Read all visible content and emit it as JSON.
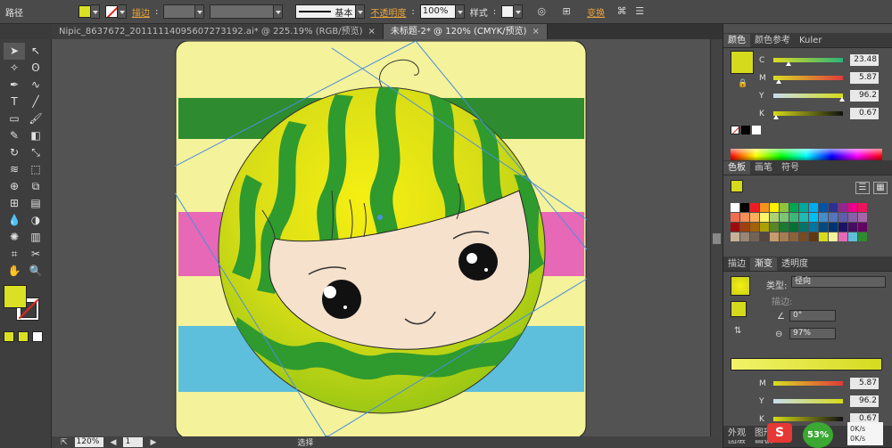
{
  "control_bar": {
    "object_type": "路径",
    "fill_color": "#dbe024",
    "stroke_label": "描边",
    "stroke_style": "基本",
    "opacity_label": "不透明度",
    "opacity_value": "100%",
    "style_label": "样式",
    "transform_label": "变换"
  },
  "tabs": [
    {
      "title": "Nipic_8637672_20111114095607273192.ai* @ 225.19% (RGB/预览)",
      "close": "×"
    },
    {
      "title": "未标题-2* @ 120% (CMYK/预览)",
      "close": "×"
    }
  ],
  "status": {
    "zoom": "120%",
    "artboard": "1",
    "mode": "选择"
  },
  "color_panel": {
    "tabs": [
      "颜色",
      "颜色参考",
      "Kuler"
    ],
    "current_color": "#d6da1c",
    "channels": [
      {
        "name": "C",
        "value": "23.48"
      },
      {
        "name": "M",
        "value": "5.87"
      },
      {
        "name": "Y",
        "value": "96.2"
      },
      {
        "name": "K",
        "value": "0.67"
      }
    ]
  },
  "swatches_panel": {
    "tabs": [
      "色板",
      "画笔",
      "符号"
    ]
  },
  "gradient_panel": {
    "tabs": [
      "描边",
      "渐变",
      "透明度"
    ],
    "type_label": "类型:",
    "type_value": "径向",
    "stroke_label": "描边:",
    "angle": "0°",
    "aspect": "97%",
    "channels": [
      {
        "name": "M",
        "value": "5.87"
      },
      {
        "name": "Y",
        "value": "96.2"
      },
      {
        "name": "K",
        "value": "0.67"
      }
    ],
    "bottom_tabs": [
      "外观",
      "图形样式"
    ],
    "layers_tabs": [
      "图层",
      "画板"
    ]
  },
  "tray": {
    "ime": "S",
    "net_percent": "53%",
    "up": "0K/s",
    "down": "0K/s"
  },
  "tools": [
    "selection-tool",
    "direct-selection-tool",
    "magic-wand-tool",
    "lasso-tool",
    "pen-tool",
    "curvature-tool",
    "type-tool",
    "line-tool",
    "rectangle-tool",
    "paintbrush-tool",
    "pencil-tool",
    "eraser-tool",
    "rotate-tool",
    "scale-tool",
    "width-tool",
    "free-transform-tool",
    "shape-builder-tool",
    "perspective-tool",
    "mesh-tool",
    "gradient-tool",
    "eyedropper-tool",
    "blend-tool",
    "symbol-sprayer-tool",
    "column-graph-tool",
    "artboard-tool",
    "slice-tool",
    "hand-tool",
    "zoom-tool"
  ]
}
